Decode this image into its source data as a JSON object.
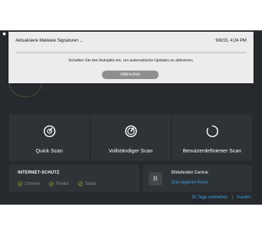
{
  "dialog": {
    "title": "Aktualisiere Malware Signaturen ...",
    "timestamp": "9/8/15, 4:24 PM",
    "message": "Schalten Sie den Autopilot ein, um automatische Updates zu aktivieren.",
    "cancel_label": "Abbrechen",
    "progress": 0
  },
  "scans": [
    {
      "label": "Quick Scan",
      "icon": "quick-scan-icon"
    },
    {
      "label": "Vollständiger Scan",
      "icon": "full-scan-icon"
    },
    {
      "label": "Benutzerdefinierter Scan",
      "icon": "custom-scan-icon"
    }
  ],
  "internet": {
    "heading": "INTERNET-SCHUTZ",
    "browsers": [
      "Chrome",
      "Firefox",
      "Safari"
    ]
  },
  "central": {
    "icon_letter": "B",
    "title": "Bitdefender Central",
    "link": "Zum eigenen Konto"
  },
  "footer": {
    "days_left": "30 Tage verbleiben",
    "buy": "Kaufen"
  },
  "colors": {
    "background": "#262a2f",
    "tile": "#2e3338",
    "accent": "#3f9fe0",
    "check": "#8cae2a",
    "dialog": "#ececec"
  }
}
